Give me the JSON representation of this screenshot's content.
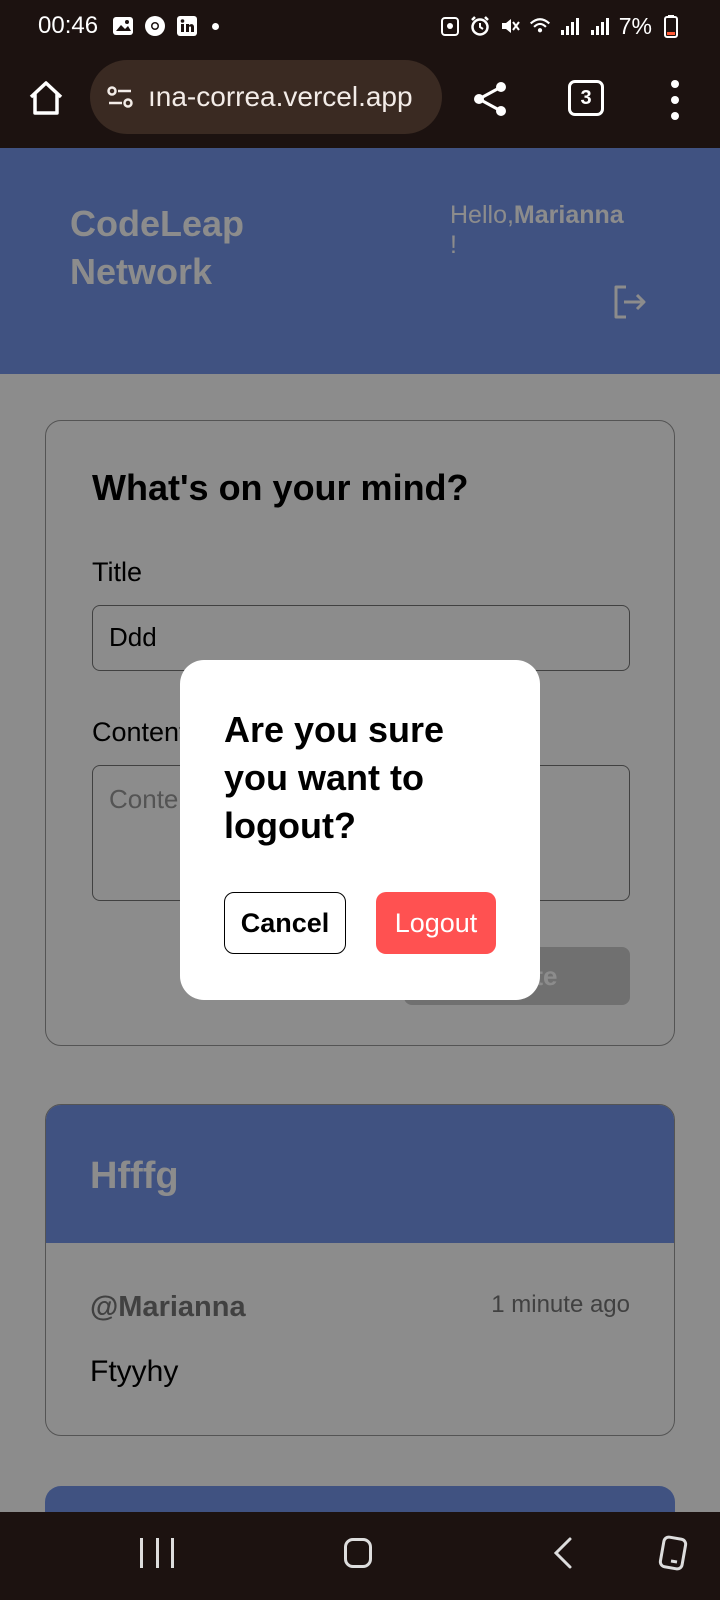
{
  "status_bar": {
    "time": "00:46",
    "battery": "7%",
    "battery_color": "#ff5a36"
  },
  "browser": {
    "url": "ına-correa.vercel.app",
    "tab_count": "3"
  },
  "header": {
    "brand": "CodeLeap Network",
    "greeting_prefix": "Hello,",
    "username": "Marianna",
    "greeting_suffix": "!"
  },
  "create_post": {
    "heading": "What's on your mind?",
    "title_label": "Title",
    "title_value": "Ddd",
    "content_label": "Content",
    "content_placeholder": "Content here",
    "create_button": "Create"
  },
  "posts": [
    {
      "title": "Hfffg",
      "author": "@Marianna",
      "time": "1 minute ago",
      "body": "Ftyyhy"
    }
  ],
  "modal": {
    "message": "Are you sure you want to logout?",
    "cancel_label": "Cancel",
    "logout_label": "Logout"
  },
  "colors": {
    "header_bg": "#7695ec",
    "logout_button": "#ff5151",
    "system_bar": "#1c1210"
  }
}
